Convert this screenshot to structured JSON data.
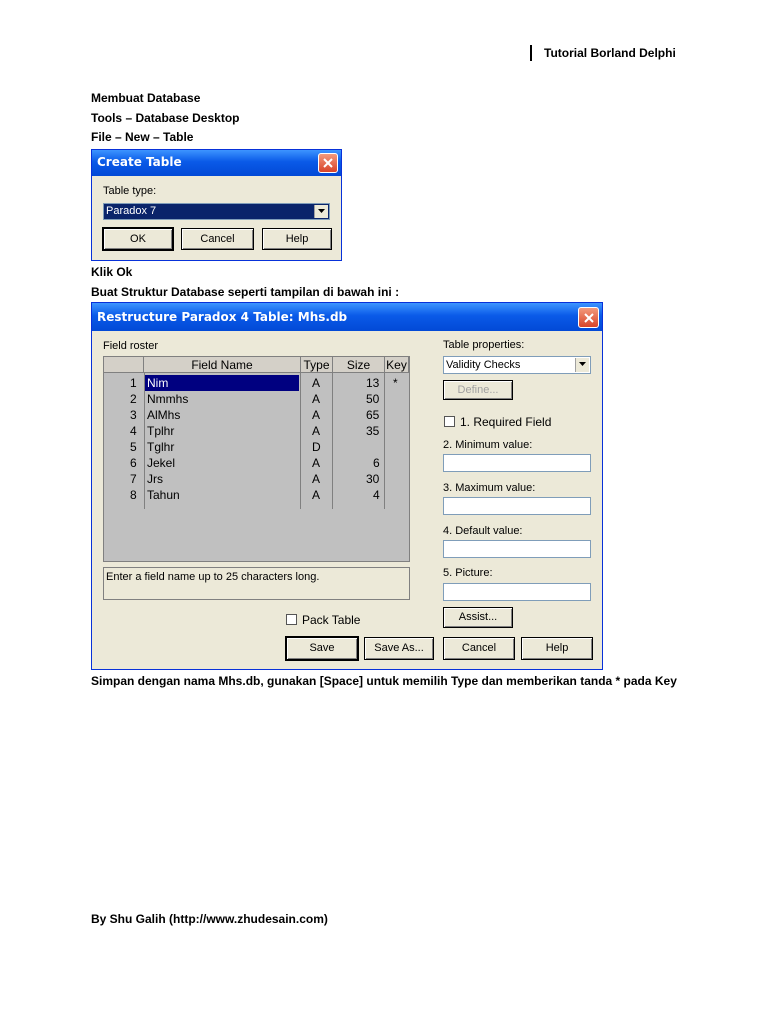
{
  "doc": {
    "header": "Tutorial Borland Delphi",
    "lines": [
      "Membuat Database",
      "Tools – Database Desktop",
      "File – New – Table"
    ],
    "klik_ok": "Klik Ok",
    "buat": "Buat Struktur Database seperti tampilan di bawah ini :",
    "simpan": "Simpan dengan nama Mhs.db, gunakan [Space] untuk memilih Type dan memberikan tanda * pada Key",
    "footer": "By Shu Galih (http://www.zhudesain.com)"
  },
  "create_table": {
    "title": "Create Table",
    "type_label": "Table type:",
    "type_value": "Paradox 7",
    "ok": "OK",
    "cancel": "Cancel",
    "help": "Help"
  },
  "restructure": {
    "title": "Restructure Paradox 4 Table: Mhs.db",
    "field_roster": "Field roster",
    "columns": {
      "name": "Field Name",
      "type": "Type",
      "size": "Size",
      "key": "Key"
    },
    "rows": [
      {
        "num": "1",
        "name": "Nim",
        "type": "A",
        "size": "13",
        "key": "*"
      },
      {
        "num": "2",
        "name": "Nmmhs",
        "type": "A",
        "size": "50",
        "key": ""
      },
      {
        "num": "3",
        "name": "AlMhs",
        "type": "A",
        "size": "65",
        "key": ""
      },
      {
        "num": "4",
        "name": "Tplhr",
        "type": "A",
        "size": "35",
        "key": ""
      },
      {
        "num": "5",
        "name": "Tglhr",
        "type": "D",
        "size": "",
        "key": ""
      },
      {
        "num": "6",
        "name": "Jekel",
        "type": "A",
        "size": "6",
        "key": ""
      },
      {
        "num": "7",
        "name": "Jrs",
        "type": "A",
        "size": "30",
        "key": ""
      },
      {
        "num": "8",
        "name": "Tahun",
        "type": "A",
        "size": "4",
        "key": ""
      }
    ],
    "hint": "Enter a field name up to 25 characters long.",
    "pack_table": "Pack Table",
    "table_properties": "Table properties:",
    "properties_value": "Validity Checks",
    "define": "Define...",
    "required_field": "1. Required Field",
    "min_value": "2. Minimum value:",
    "max_value": "3. Maximum value:",
    "default_value": "4. Default value:",
    "picture": "5. Picture:",
    "assist": "Assist...",
    "save": "Save",
    "save_as": "Save As...",
    "cancel": "Cancel",
    "help": "Help"
  }
}
